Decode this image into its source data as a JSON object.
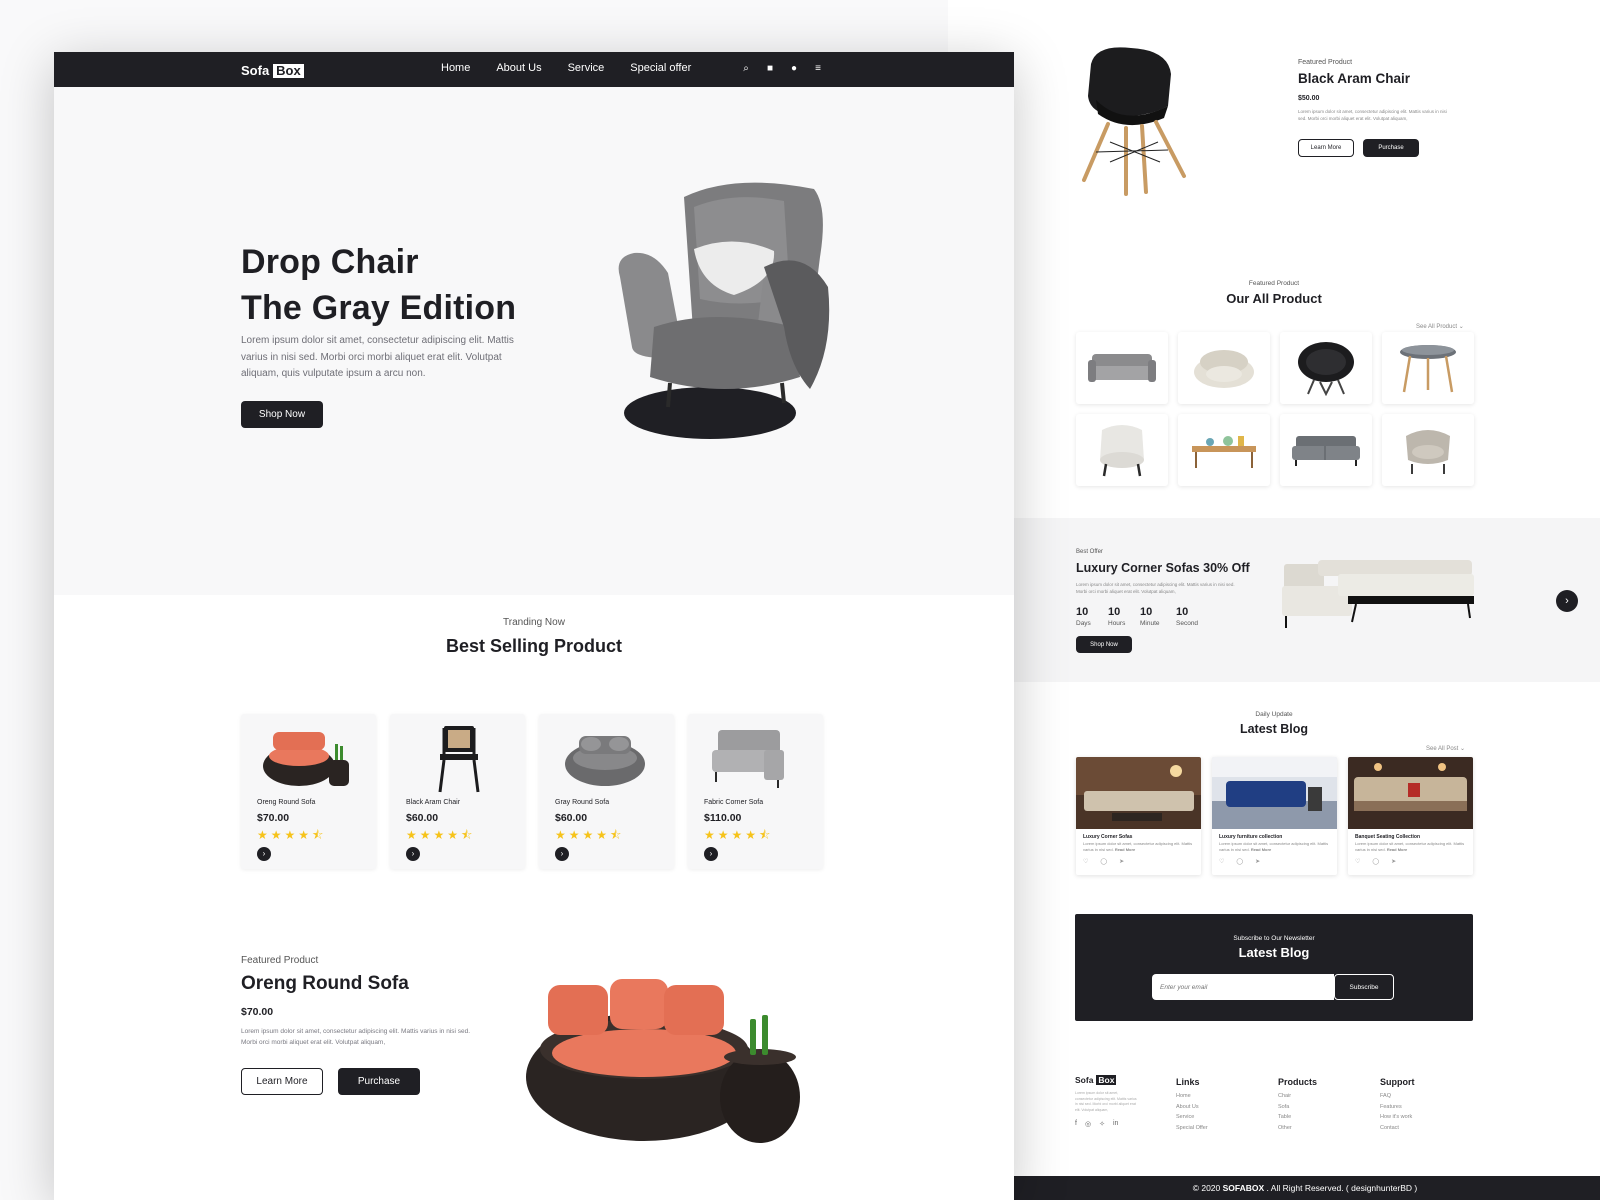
{
  "nav": {
    "logo_a": "Sofa",
    "logo_b": "Box",
    "links": [
      "Home",
      "About Us",
      "Service",
      "Special offer"
    ]
  },
  "hero": {
    "title_1": "Drop Chair",
    "title_2": "The Gray Edition",
    "body": "Lorem ipsum dolor sit amet, consectetur adipiscing elit. Mattis varius in nisi sed. Morbi orci morbi aliquet erat elit. Volutpat aliquam, quis vulputate ipsum a arcu non.",
    "cta": "Shop Now"
  },
  "best": {
    "sub": "Tranding Now",
    "title": "Best Selling Product",
    "items": [
      {
        "name": "Oreng Round Sofa",
        "price": "$70.00",
        "stars": "★★★★⯪"
      },
      {
        "name": "Black Aram Chair",
        "price": "$60.00",
        "stars": "★★★★⯪"
      },
      {
        "name": "Gray Round Sofa",
        "price": "$60.00",
        "stars": "★★★★⯪"
      },
      {
        "name": "Fabric Corner Sofa",
        "price": "$110.00",
        "stars": "★★★★⯪"
      }
    ],
    "rating": 4.5
  },
  "featured": {
    "sub": "Featured Product",
    "title": "Oreng Round Sofa",
    "price": "$70.00",
    "body": "Lorem ipsum dolor sit amet, consectetur adipiscing elit. Mattis varius in nisi sed. Morbi orci morbi aliquet erat elit. Volutpat aliquam,",
    "learn": "Learn More",
    "buy": "Purchase"
  },
  "right": {
    "feat_sub": "Featured Product",
    "feat_title": "Black Aram Chair",
    "feat_price": "$50.00",
    "feat_body": "Lorem ipsum dolor sit amet, consectetur adipiscing elit. Mattis varius in nisi sed. Morbi orci morbi aliquet erat elit. Volutpat aliquam,",
    "learn": "Learn More",
    "buy": "Purchase",
    "all_sub": "Featured Product",
    "all_title": "Our All Product",
    "see_all": "See All Product",
    "offer_sub": "Best Offer",
    "offer_title": "Luxury Corner Sofas 30% Off",
    "offer_body": "Lorem ipsum dolor sit amet, consectetur adipiscing elit. Mattis varius in nisi sed. Morbi orci morbi aliquet erat elit. Volutpat aliquam,",
    "countdown": [
      {
        "n": "10",
        "l": "Days"
      },
      {
        "n": "10",
        "l": "Hours"
      },
      {
        "n": "10",
        "l": "Minute"
      },
      {
        "n": "10",
        "l": "Second"
      }
    ],
    "offer_cta": "Shop Now",
    "blog_sub": "Daily Update",
    "blog_title": "Latest Blog",
    "see_post": "See All Post",
    "blogs": [
      {
        "t": "Luxury Corner Sofas",
        "d": "Lorem ipsum dolor sit amet, consectetur adipiscing elit. Mattis varius in nisi sed.",
        "more": "Read More"
      },
      {
        "t": "Luxury furniture collection",
        "d": "Lorem ipsum dolor sit amet, consectetur adipiscing elit. Mattis varius in nisi sed.",
        "more": "Read More"
      },
      {
        "t": "Banquet Seating Collection",
        "d": "Lorem ipsum dolor sit amet, consectetur adipiscing elit. Mattis varius in nisi sed.",
        "more": "Read More"
      }
    ],
    "news_sub": "Subscribe to Our Newsletter",
    "news_title": "Latest Blog",
    "news_placeholder": "Enter your email",
    "news_btn": "Subscribe",
    "foot_about": "Lorem ipsum dolor sit amet, consectetur adipiscing elit. Mattis varius in nisi sed. Morbi orci morbi aliquet erat elit. Volutpat aliquam,",
    "foot_cols": [
      {
        "h": "Links",
        "items": [
          "Home",
          "About Us",
          "Service",
          "Special Offer"
        ]
      },
      {
        "h": "Products",
        "items": [
          "Chair",
          "Sofa",
          "Table",
          "Other"
        ]
      },
      {
        "h": "Support",
        "items": [
          "FAQ",
          "Features",
          "How it's work",
          "Contact"
        ]
      }
    ],
    "copyright_a": "© 2020 ",
    "copyright_b": "SOFABOX",
    "copyright_c": " . All Right Reserved. ( designhunterBD )"
  },
  "colors": {
    "dark": "#1f1f24",
    "star": "#f6c31a",
    "accent_sofa": "#e9785d"
  }
}
